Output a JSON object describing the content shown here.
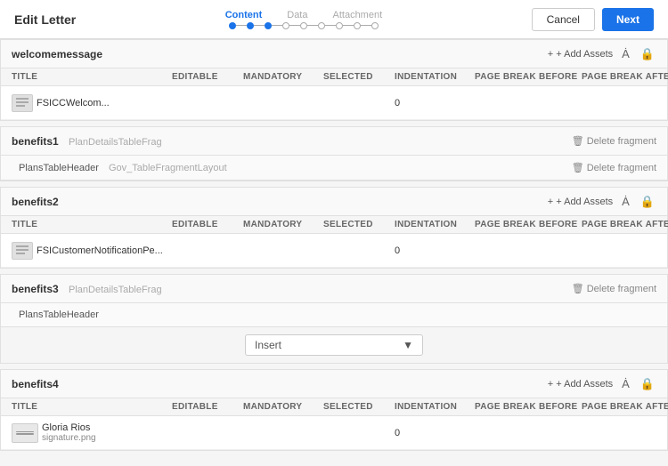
{
  "header": {
    "title": "Edit Letter",
    "steps": {
      "labels": [
        "Content",
        "Data",
        "Attachment"
      ],
      "active": "Content"
    },
    "buttons": {
      "cancel": "Cancel",
      "next": "Next"
    }
  },
  "sections": [
    {
      "id": "welcomemessage",
      "title": "welcomemessage",
      "subtitle": "",
      "type": "table",
      "actions": [
        "add_assets",
        "font",
        "lock"
      ],
      "columns": [
        "TITLE",
        "EDITABLE",
        "MANDATORY",
        "SELECTED",
        "INDENTATION",
        "PAGE BREAK BEFORE",
        "PAGE BREAK AFTER",
        ""
      ],
      "rows": [
        {
          "name": "FSICCWelcom...",
          "editable": "",
          "mandatory": "",
          "selected": "",
          "indentation": "0",
          "page_break_before": "",
          "page_break_after": ""
        }
      ]
    },
    {
      "id": "benefits1",
      "title": "benefits1",
      "subtitle": "PlanDetailsTableFrag",
      "type": "fragment",
      "actions": [
        "delete_fragment"
      ],
      "sub_rows": [
        {
          "name": "PlansTableHeader",
          "layout": "Gov_TableFragmentLayout"
        }
      ]
    },
    {
      "id": "benefits2",
      "title": "benefits2",
      "subtitle": "",
      "type": "table",
      "actions": [
        "add_assets",
        "font",
        "lock"
      ],
      "columns": [
        "TITLE",
        "EDITABLE",
        "MANDATORY",
        "SELECTED",
        "INDENTATION",
        "PAGE BREAK BEFORE",
        "PAGE BREAK AFTER",
        ""
      ],
      "rows": [
        {
          "name": "FSICustomerNotificationPe...",
          "editable": "",
          "mandatory": "",
          "selected": "",
          "indentation": "0",
          "page_break_before": "",
          "page_break_after": ""
        }
      ]
    },
    {
      "id": "benefits3",
      "title": "benefits3",
      "subtitle": "PlanDetailsTableFrag",
      "type": "fragment_with_insert",
      "actions": [
        "delete_fragment"
      ],
      "sub_rows": [
        {
          "name": "PlansTableHeader",
          "layout": ""
        }
      ],
      "insert_label": "Insert"
    },
    {
      "id": "benefits4",
      "title": "benefits4",
      "subtitle": "",
      "type": "table",
      "actions": [
        "add_assets",
        "font",
        "lock"
      ],
      "columns": [
        "TITLE",
        "EDITABLE",
        "MANDATORY",
        "SELECTED",
        "INDENTATION",
        "PAGE BREAK BEFORE",
        "PAGE BREAK AFTER",
        ""
      ],
      "rows": [
        {
          "name": "Gloria Rios",
          "sub_name": "signature.png",
          "editable": "",
          "mandatory": "",
          "selected": "",
          "indentation": "0",
          "page_break_before": "",
          "page_break_after": ""
        }
      ]
    }
  ],
  "icons": {
    "add": "+",
    "edit": "✎",
    "delete": "🗑",
    "chevron_right": "›",
    "plus": "+",
    "font": "A",
    "lock": "🔒",
    "delete_fragment_label": "Delete fragment",
    "add_assets_label": "+ Add Assets"
  }
}
